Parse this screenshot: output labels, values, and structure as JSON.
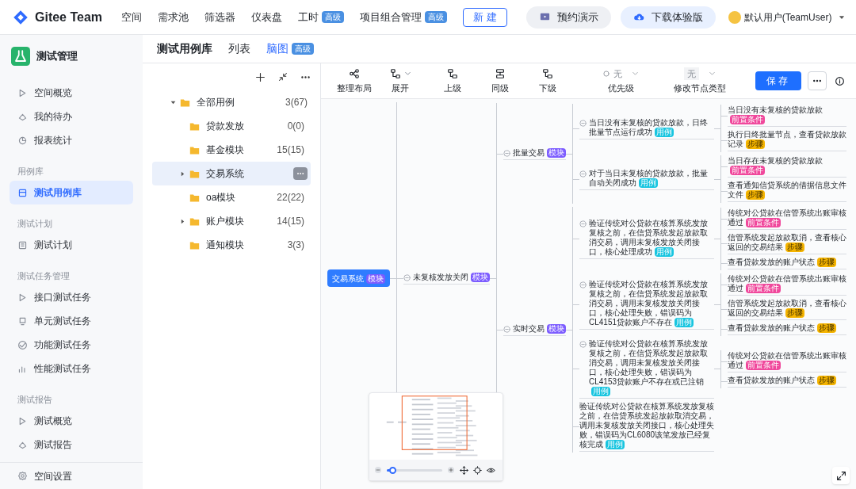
{
  "top_nav": {
    "brand": "Gitee Team",
    "items": [
      {
        "label": "空间"
      },
      {
        "label": "需求池"
      },
      {
        "label": "筛选器"
      },
      {
        "label": "仪表盘"
      },
      {
        "label": "工时",
        "badge": "高级"
      },
      {
        "label": "项目组合管理",
        "badge": "高级"
      }
    ],
    "new_button": "新 建",
    "demo_button": "预约演示",
    "download_button": "下载体验版",
    "user": "默认用户(TeamUser)"
  },
  "sidebar": {
    "title": "测试管理",
    "sections": [
      {
        "items": [
          {
            "label": "空间概览",
            "selected": false
          },
          {
            "label": "我的待办",
            "selected": false
          },
          {
            "label": "报表统计",
            "selected": false
          }
        ]
      },
      {
        "heading": "用例库",
        "items": [
          {
            "label": "测试用例库",
            "selected": true
          }
        ]
      },
      {
        "heading": "测试计划",
        "items": [
          {
            "label": "测试计划",
            "selected": false
          }
        ]
      },
      {
        "heading": "测试任务管理",
        "items": [
          {
            "label": "接口测试任务",
            "selected": false
          },
          {
            "label": "单元测试任务",
            "selected": false
          },
          {
            "label": "功能测试任务",
            "selected": false
          },
          {
            "label": "性能测试任务",
            "selected": false
          }
        ]
      },
      {
        "heading": "测试报告",
        "items": [
          {
            "label": "测试概览",
            "selected": false
          },
          {
            "label": "测试报告",
            "selected": false
          }
        ]
      }
    ],
    "footer": "空间设置"
  },
  "header": {
    "title": "测试用例库",
    "views": [
      {
        "label": "列表",
        "selected": false
      },
      {
        "label": "脑图",
        "selected": true,
        "badge": "高级"
      }
    ]
  },
  "case_tree": {
    "root": {
      "label": "全部用例",
      "count": "3(67)",
      "expanded": true,
      "children": [
        {
          "label": "贷款发放",
          "count": "0(0)",
          "selected": false,
          "has_children": false
        },
        {
          "label": "基金模块",
          "count": "15(15)",
          "selected": false,
          "has_children": false
        },
        {
          "label": "交易系统",
          "selected": true,
          "has_children": true
        },
        {
          "label": "oa模块",
          "count": "22(22)",
          "selected": false,
          "has_children": false
        },
        {
          "label": "账户模块",
          "count": "14(15)",
          "selected": false,
          "has_children": true
        },
        {
          "label": "通知模块",
          "count": "3(3)",
          "selected": false,
          "has_children": false
        }
      ]
    }
  },
  "toolbar": {
    "tools": [
      {
        "label": "整理布局",
        "kind": "layout"
      },
      {
        "label": "展开",
        "kind": "expand"
      },
      {
        "label": "上级",
        "kind": "parent"
      },
      {
        "label": "同级",
        "kind": "sibling"
      },
      {
        "label": "下级",
        "kind": "child"
      }
    ],
    "priority": {
      "label": "优先级",
      "value": "无",
      "disabled": true
    },
    "node_type": {
      "label": "修改节点类型",
      "value": "无",
      "disabled": true
    },
    "save": "保存"
  },
  "mind_map": {
    "root": {
      "text": "交易系统",
      "tag": {
        "label": "模块",
        "color": "#7c5cff"
      },
      "children": [
        {
          "text": "未复核发放关闭",
          "tag": {
            "label": "模块",
            "color": "#7c5cff"
          },
          "children": [
            {
              "text": "批量交易",
              "tag": {
                "label": "模块",
                "color": "#7c5cff"
              },
              "children": [
                {
                  "text": "当日没有未复核的贷款放款，日终批量节点运行成功",
                  "tag": {
                    "label": "用例",
                    "color": "#18c5e0"
                  },
                  "children": [
                    {
                      "text": "当日没有未复核的贷款放款",
                      "tag": {
                        "label": "前置条件",
                        "color": "#f0489c"
                      }
                    },
                    {
                      "text": "执行日终批量节点，查看贷款放款记录",
                      "tag": {
                        "label": "步骤",
                        "color": "#f5b400"
                      }
                    }
                  ]
                },
                {
                  "text": "对于当日未复核的贷款放款，批量自动关闭成功",
                  "tag": {
                    "label": "用例",
                    "color": "#18c5e0"
                  },
                  "children": [
                    {
                      "text": "当日存在未复核的贷款放款",
                      "tag": {
                        "label": "前置条件",
                        "color": "#f0489c"
                      }
                    },
                    {
                      "text": "查看通知信贷系统的借据信息文件文件",
                      "tag": {
                        "label": "步骤",
                        "color": "#f5b400"
                      }
                    }
                  ]
                }
              ]
            },
            {
              "text": "实时交易",
              "tag": {
                "label": "模块",
                "color": "#7c5cff"
              },
              "children": [
                {
                  "text": "验证传统对公贷款在核算系统发放复核之前，在信贷系统发起放款取消交易，调用未复核发放关闭接口，核心处理成功",
                  "tag": {
                    "label": "用例",
                    "color": "#18c5e0"
                  },
                  "children": [
                    {
                      "text": "传统对公贷款在信管系统出账审核通过",
                      "tag": {
                        "label": "前置条件",
                        "color": "#f0489c"
                      }
                    },
                    {
                      "text": "信管系统发起放款取消，查看核心返回的交易结果",
                      "tag": {
                        "label": "步骤",
                        "color": "#f5b400"
                      }
                    },
                    {
                      "text": "查看贷款发放的账户状态",
                      "tag": {
                        "label": "步骤",
                        "color": "#f5b400"
                      }
                    }
                  ]
                },
                {
                  "text": "验证传统对公贷款在核算系统发放复核之前，在信贷系统发起放款取消交易，调用未复核发放关闭接口，核心处理失败，错误码为CL4151贷款账户不存在",
                  "tag": {
                    "label": "用例",
                    "color": "#18c5e0"
                  },
                  "children": [
                    {
                      "text": "传统对公贷款在信管系统出账审核通过",
                      "tag": {
                        "label": "前置条件",
                        "color": "#f0489c"
                      }
                    },
                    {
                      "text": "信管系统发起放款取消，查看核心返回的交易结果",
                      "tag": {
                        "label": "步骤",
                        "color": "#f5b400"
                      }
                    },
                    {
                      "text": "查看贷款发放的账户状态",
                      "tag": {
                        "label": "步骤",
                        "color": "#f5b400"
                      }
                    }
                  ]
                },
                {
                  "text": "验证传统对公贷款在核算系统发放复核之前，在信贷系统发起放款取消交易，调用未复核发放关闭接口，核心处理失败，错误码为CL4153贷款账户不存在或已注销",
                  "tag": {
                    "label": "用例",
                    "color": "#18c5e0"
                  },
                  "children": [
                    {
                      "text": "传统对公贷款在信管系统出账审核通过",
                      "tag": {
                        "label": "前置条件",
                        "color": "#f0489c"
                      }
                    },
                    {
                      "text": "查看贷款发放的账户状态",
                      "tag": {
                        "label": "步骤",
                        "color": "#f5b400"
                      }
                    }
                  ]
                },
                {
                  "text": "验证传统对公贷款在核算系统发放复核之前，在信贷系统发起放款取消交易，调用未复核发放关闭接口，核心处理失败，错误码为CL6080该笔发放已经复核完成",
                  "tag": {
                    "label": "用例",
                    "color": "#18c5e0"
                  }
                }
              ]
            }
          ]
        }
      ]
    }
  },
  "minimap": {
    "level": 0.1
  }
}
